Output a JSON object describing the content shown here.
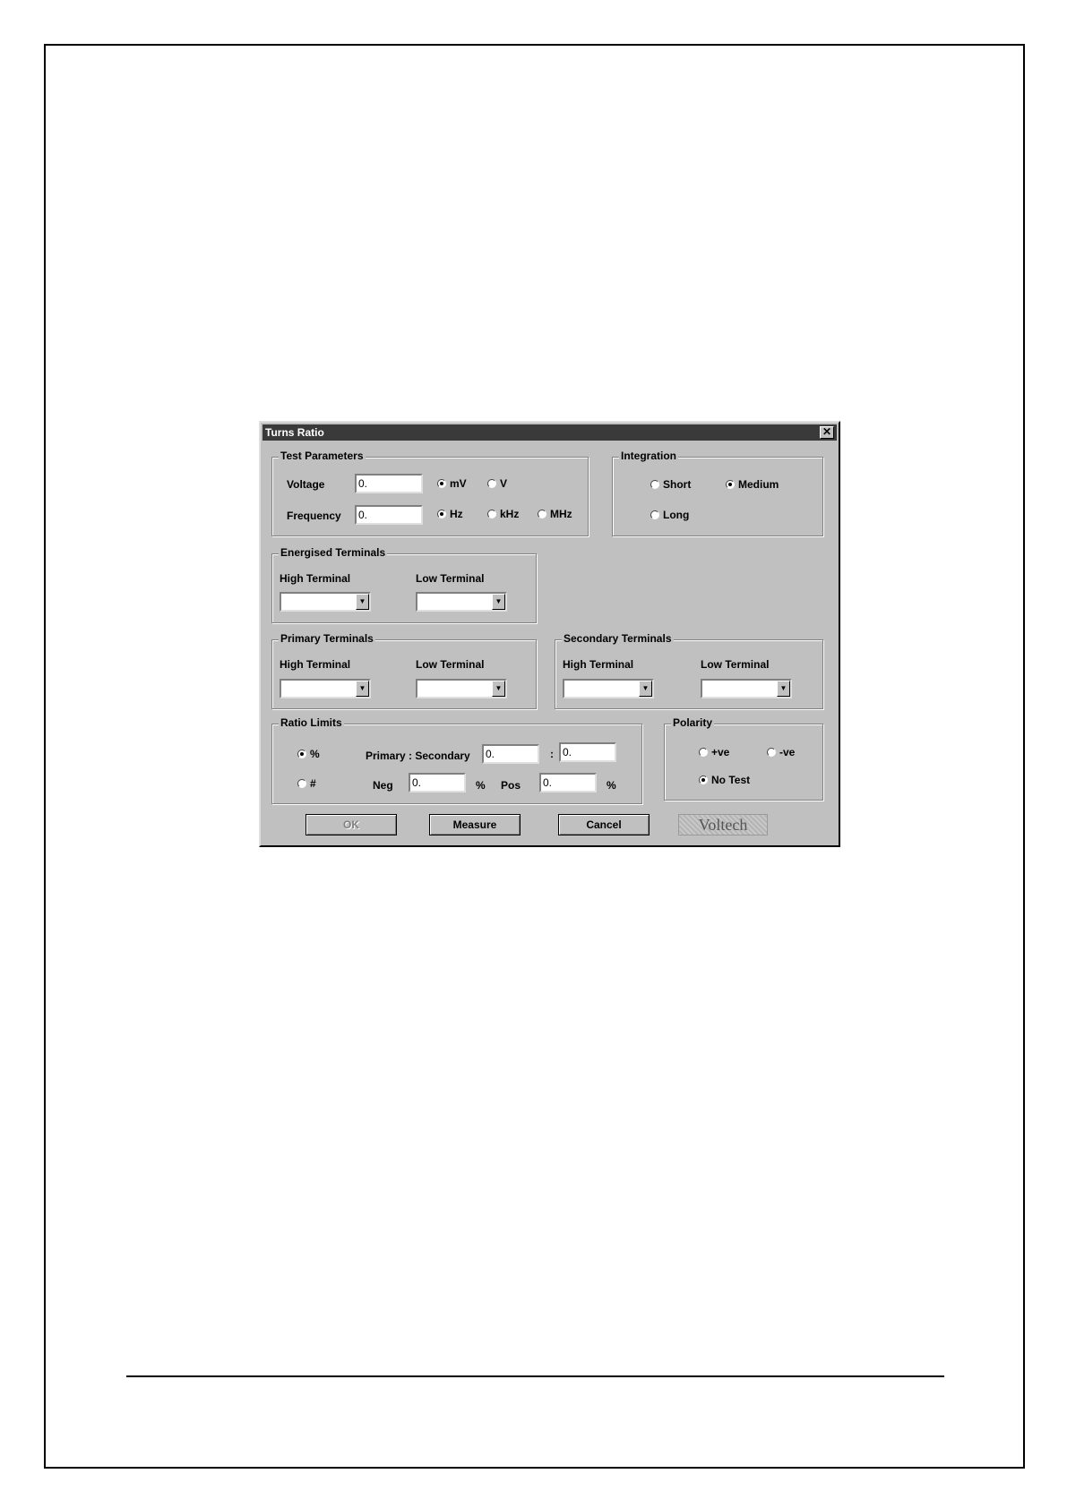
{
  "dialog": {
    "title": "Turns Ratio",
    "close_glyph": "✕",
    "test_parameters": {
      "title": "Test Parameters",
      "voltage_label": "Voltage",
      "voltage_value": "0.",
      "voltage_units": [
        {
          "label": "mV",
          "selected": true
        },
        {
          "label": "V",
          "selected": false
        }
      ],
      "frequency_label": "Frequency",
      "frequency_value": "0.",
      "frequency_units": [
        {
          "label": "Hz",
          "selected": true
        },
        {
          "label": "kHz",
          "selected": false
        },
        {
          "label": "MHz",
          "selected": false
        }
      ]
    },
    "integration": {
      "title": "Integration",
      "options": [
        {
          "label": "Short",
          "selected": false
        },
        {
          "label": "Medium",
          "selected": true
        },
        {
          "label": "Long",
          "selected": false
        }
      ]
    },
    "energised_terminals": {
      "title": "Energised Terminals",
      "high_label": "High Terminal",
      "low_label": "Low Terminal"
    },
    "primary_terminals": {
      "title": "Primary Terminals",
      "high_label": "High Terminal",
      "low_label": "Low Terminal"
    },
    "secondary_terminals": {
      "title": "Secondary Terminals",
      "high_label": "High Terminal",
      "low_label": "Low Terminal"
    },
    "ratio_limits": {
      "title": "Ratio Limits",
      "percent_option": {
        "label": "%",
        "selected": true
      },
      "number_option": {
        "label": "#",
        "selected": false
      },
      "primary_secondary_label": "Primary : Secondary",
      "primary_value": "0.",
      "colon": ":",
      "secondary_value": "0.",
      "neg_label": "Neg",
      "neg_value": "0.",
      "neg_unit": "%",
      "pos_label": "Pos",
      "pos_value": "0.",
      "pos_unit": "%"
    },
    "polarity": {
      "title": "Polarity",
      "options": [
        {
          "label": "+ve",
          "selected": false
        },
        {
          "label": "-ve",
          "selected": false
        },
        {
          "label": "No Test",
          "selected": true
        }
      ]
    },
    "buttons": {
      "ok": "OK",
      "measure": "Measure",
      "cancel": "Cancel"
    },
    "logo_text": "Voltech",
    "dropdown_arrow": "▼"
  }
}
